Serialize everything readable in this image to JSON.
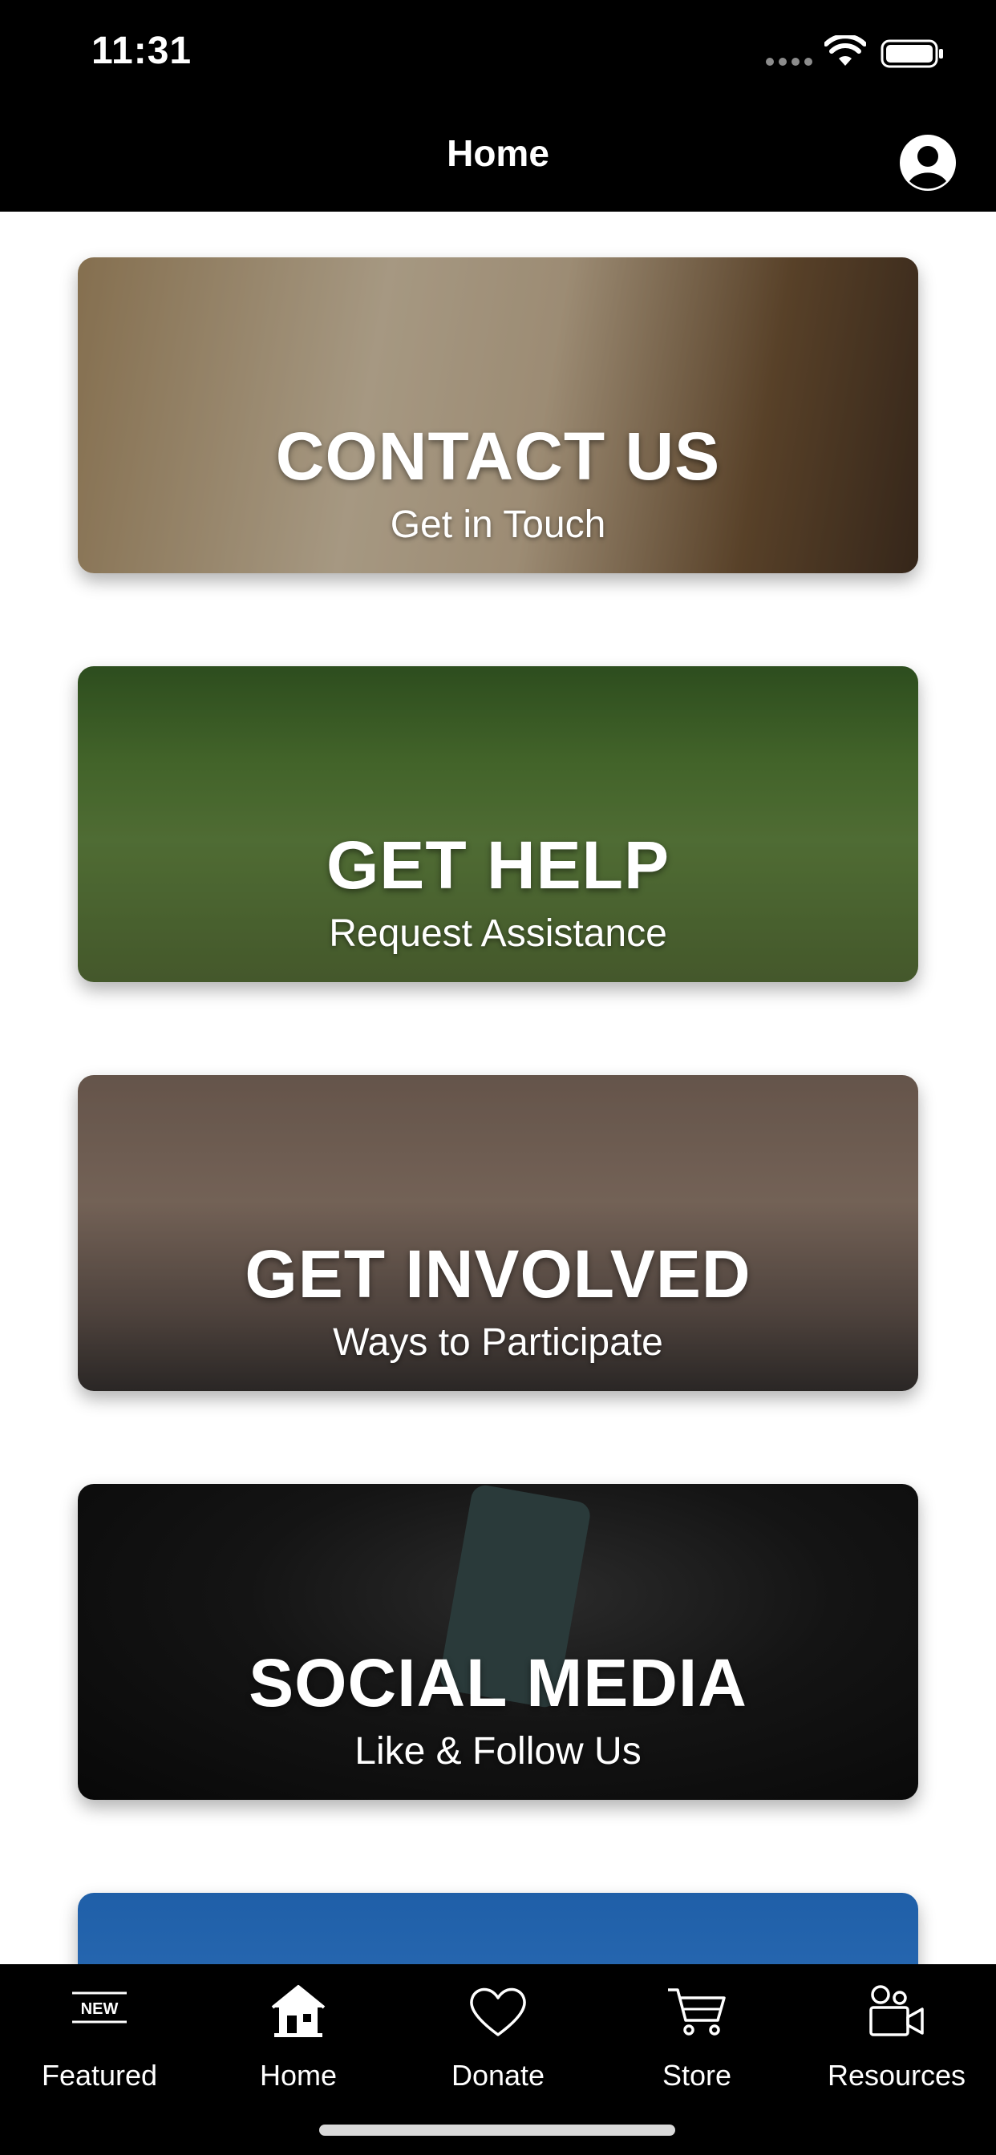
{
  "status_bar": {
    "time": "11:31"
  },
  "header": {
    "title": "Home"
  },
  "cards": [
    {
      "title": "CONTACT US",
      "subtitle": "Get in Touch"
    },
    {
      "title": "GET HELP",
      "subtitle": "Request Assistance"
    },
    {
      "title": "GET INVOLVED",
      "subtitle": "Ways to Participate"
    },
    {
      "title": "SOCIAL MEDIA",
      "subtitle": "Like & Follow Us"
    }
  ],
  "tabs": [
    {
      "label": "Featured",
      "icon": "new-badge-icon",
      "badge": "NEW"
    },
    {
      "label": "Home",
      "icon": "house-icon"
    },
    {
      "label": "Donate",
      "icon": "heart-icon"
    },
    {
      "label": "Store",
      "icon": "cart-icon"
    },
    {
      "label": "Resources",
      "icon": "video-camera-icon"
    }
  ],
  "colors": {
    "bar_background": "#000000",
    "text": "#ffffff",
    "page_background": "#ffffff"
  }
}
